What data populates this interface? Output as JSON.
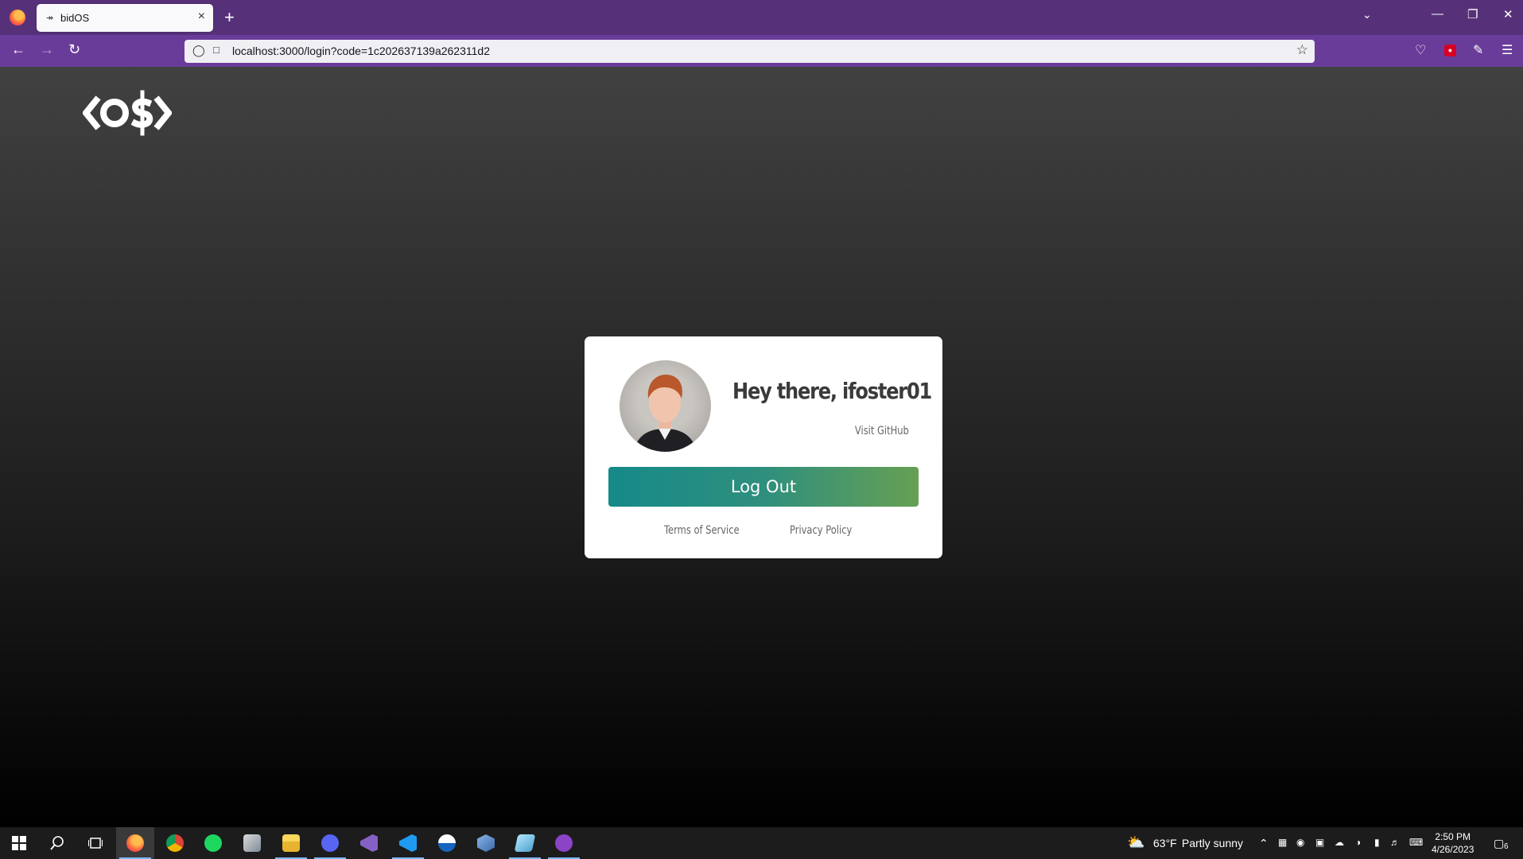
{
  "browser": {
    "tab_favicon": "↠",
    "tab_title": "bidOS",
    "tab_close": "×",
    "new_tab": "+",
    "url": "localhost:3000/login?code=1c202637139a262311d2"
  },
  "page": {
    "logo_text": "<OS>",
    "card": {
      "greeting": "Hey there, ifoster01",
      "visit_github": "Visit GitHub",
      "logout_label": "Log Out",
      "terms_label": "Terms of Service",
      "privacy_label": "Privacy Policy"
    }
  },
  "taskbar": {
    "apps": [
      "start-icon",
      "search-icon",
      "task-view-icon",
      "firefox-icon",
      "chrome-icon",
      "spotify-icon",
      "app-icon",
      "file-explorer-icon",
      "discord-icon",
      "visual-studio-icon",
      "vscode-icon",
      "app-icon",
      "virtualbox-icon",
      "app-icon",
      "github-desktop-icon"
    ],
    "weather_temp": "63°F",
    "weather_text": "Partly sunny",
    "time": "2:50 PM",
    "date": "4/26/2023",
    "notification_count": "6"
  },
  "colors": {
    "tabbar": "#56317a",
    "navbar": "#6a3c9a",
    "button_start": "#158a88",
    "button_end": "#66a053"
  }
}
